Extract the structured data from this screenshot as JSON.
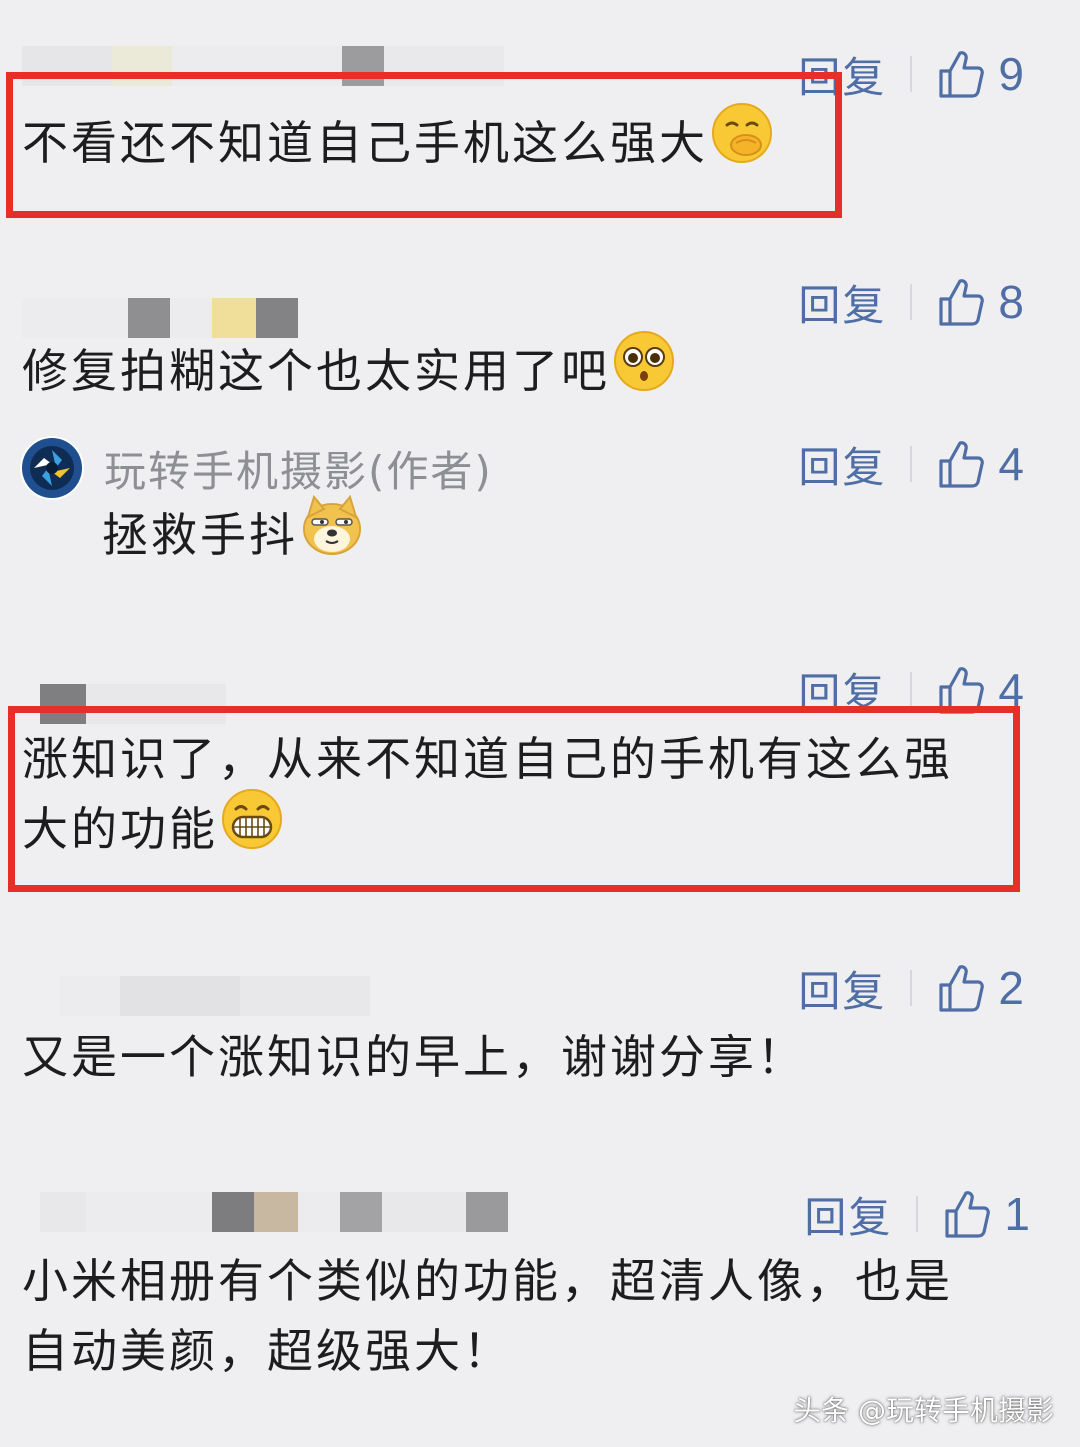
{
  "colors": {
    "background": "#efeff1",
    "accent": "#4f6ea5",
    "highlight_border": "#e63027",
    "text": "#1d1d1f",
    "author_name": "#8e8f94"
  },
  "comments": [
    {
      "reply_label": "回复",
      "like_count": "9",
      "text": "不看还不知道自己手机这么强大",
      "emoji": "thinking-face-icon",
      "highlighted": true
    },
    {
      "reply_label": "回复",
      "like_count": "8",
      "text": "修复拍糊这个也太实用了吧",
      "emoji": "pleading-face-icon",
      "highlighted": false
    },
    {
      "author": "玩转手机摄影(作者)",
      "reply_label": "回复",
      "like_count": "4",
      "text": "拯救手抖",
      "emoji": "doge-icon",
      "highlighted": false
    },
    {
      "reply_label": "回复",
      "like_count": "4",
      "text_line1": "涨知识了，从来不知道自己的手机有这么强",
      "text_line2": "大的功能",
      "emoji": "grinning-face-icon",
      "highlighted": true
    },
    {
      "reply_label": "回复",
      "like_count": "2",
      "text": "又是一个涨知识的早上，谢谢分享！",
      "highlighted": false
    },
    {
      "reply_label": "回复",
      "like_count": "1",
      "text_line1": "小米相册有个类似的功能，超清人像，也是",
      "text_line2": "自动美颜，超级强大！",
      "highlighted": false
    }
  ],
  "watermark": "头条 @玩转手机摄影"
}
